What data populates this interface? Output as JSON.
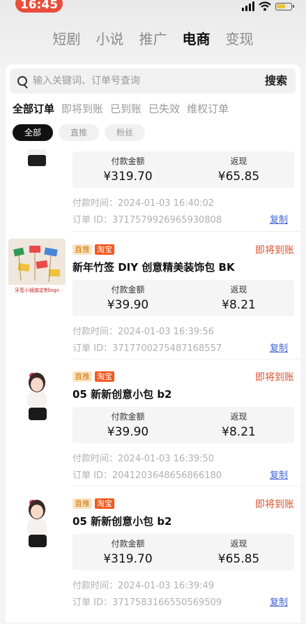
{
  "status_bar": {
    "time": "16:45"
  },
  "top_nav": [
    "短剧",
    "小说",
    "推广",
    "电商",
    "变现"
  ],
  "search": {
    "placeholder": "输入关键词、订单号查询",
    "button": "搜索"
  },
  "filters": [
    "全部订单",
    "即将到账",
    "已到账",
    "已失效",
    "维权订单"
  ],
  "chips": [
    "全部",
    "直推",
    "粉丝"
  ],
  "labels": {
    "pay_amount": "付款金额",
    "rebate": "返现",
    "copy": "复制"
  },
  "orders": [
    {
      "tags": [],
      "status": "",
      "title": "",
      "pay": "¥319.70",
      "rebate": "¥65.85",
      "time": "付款时间：2024-01-03 16:40:02",
      "order_id": "订单 ID：3717579926965930808"
    },
    {
      "tags": [
        "直推",
        "淘宝"
      ],
      "status": "即将到账",
      "title": "新年竹签 DIY 创意精美装饰包 BK",
      "pay": "¥39.90",
      "rebate": "¥8.21",
      "time": "付款时间：2024-01-03 16:39:56",
      "order_id": "订单 ID：3717700275487168557",
      "thumb_caption": "牙签小插旗定制logo"
    },
    {
      "tags": [
        "直推",
        "淘宝"
      ],
      "status": "即将到账",
      "title": "05 新新创意小包 b2",
      "pay": "¥39.90",
      "rebate": "¥8.21",
      "time": "付款时间：2024-01-03 16:39:50",
      "order_id": "订单 ID：2041203648656866180"
    },
    {
      "tags": [
        "直推",
        "淘宝"
      ],
      "status": "即将到账",
      "title": "05 新新创意小包 b2",
      "pay": "¥319.70",
      "rebate": "¥65.85",
      "time": "付款时间：2024-01-03 16:39:49",
      "order_id": "订单 ID：3717583166550569509"
    }
  ]
}
